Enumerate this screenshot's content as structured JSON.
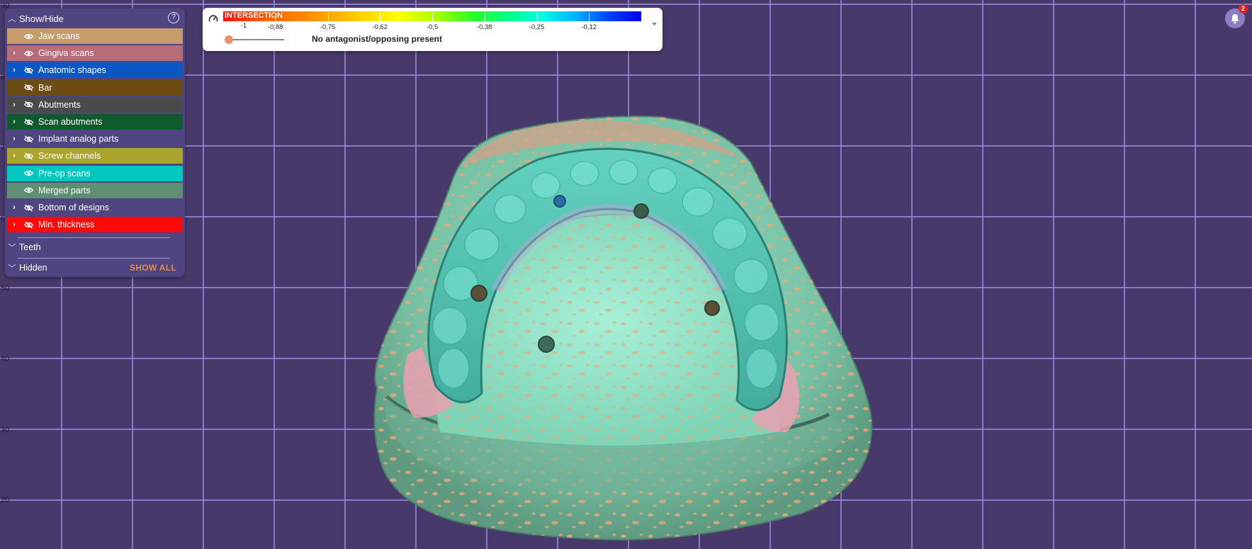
{
  "ruler": {
    "labels": [
      "90",
      "8",
      "7",
      "6",
      "50",
      "40",
      "30",
      "20"
    ]
  },
  "show_hide": {
    "title": "Show/Hide",
    "help_icon": "help-circle-icon",
    "layers": [
      {
        "label": "Jaw scans",
        "color": "#c69c6c",
        "expandable": false,
        "visible": true
      },
      {
        "label": "Gingiva scans",
        "color": "#b76c79",
        "expandable": true,
        "visible": true
      },
      {
        "label": "Anatomic shapes",
        "color": "#0a58c5",
        "expandable": true,
        "visible": false
      },
      {
        "label": "Bar",
        "color": "#6d4c14",
        "expandable": false,
        "visible": false
      },
      {
        "label": "Abutments",
        "color": "#4a4a4a",
        "expandable": true,
        "visible": false
      },
      {
        "label": "Scan abutments",
        "color": "#0f5a2f",
        "expandable": true,
        "visible": false
      },
      {
        "label": "Implant analog parts",
        "color": "#4f4581",
        "expandable": true,
        "visible": false
      },
      {
        "label": "Screw channels",
        "color": "#a8a42c",
        "expandable": true,
        "visible": false
      },
      {
        "label": "Pre-op scans",
        "color": "#00c8c0",
        "expandable": false,
        "visible": true
      },
      {
        "label": "Merged parts",
        "color": "#5f8f73",
        "expandable": false,
        "visible": true
      },
      {
        "label": "Bottom of designs",
        "color": "#4f4581",
        "expandable": true,
        "visible": false
      },
      {
        "label": "Min. thickness",
        "color": "#ff0a0a",
        "expandable": true,
        "visible": false
      }
    ],
    "teeth_label": "Teeth",
    "hidden_label": "Hidden",
    "show_all_label": "SHOW ALL"
  },
  "legend": {
    "title": "INTERSECTION",
    "ticks": [
      "-0,88",
      "-0,75",
      "-0,62",
      "-0,5",
      "-0,38",
      "-0,25",
      "-0,12"
    ],
    "min_label": "-1",
    "message": "No antagonist/opposing present",
    "gauge_icon": "gauge-icon",
    "toggle_icon": "chevron-down-icon"
  },
  "notifications": {
    "count": "2",
    "icon": "bell-icon"
  }
}
